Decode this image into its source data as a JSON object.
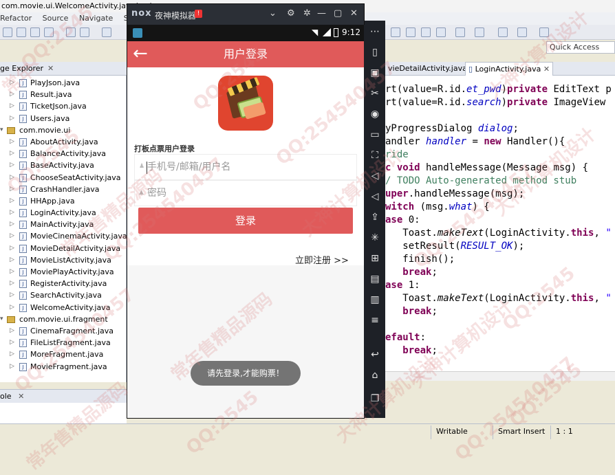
{
  "eclipse": {
    "window_title": "com.movie.ui.WelcomeActivity.java/src/co",
    "menu": [
      "Refactor",
      "Source",
      "Navigate",
      "Se"
    ],
    "quick_access": "Quick Access",
    "package_explorer_title": "ge Explorer",
    "tree": [
      {
        "type": "file",
        "label": "PlayJson.java"
      },
      {
        "type": "file",
        "label": "Result.java"
      },
      {
        "type": "file",
        "label": "TicketJson.java"
      },
      {
        "type": "file",
        "label": "Users.java"
      },
      {
        "type": "package",
        "label": "com.movie.ui"
      },
      {
        "type": "file",
        "label": "AboutActivity.java"
      },
      {
        "type": "file",
        "label": "BalanceActivity.java"
      },
      {
        "type": "file",
        "label": "BaseActivity.java"
      },
      {
        "type": "file",
        "label": "ChooseSeatActivity.java"
      },
      {
        "type": "file",
        "label": "CrashHandler.java"
      },
      {
        "type": "file",
        "label": "HHApp.java"
      },
      {
        "type": "file",
        "label": "LoginActivity.java"
      },
      {
        "type": "file",
        "label": "MainActivity.java"
      },
      {
        "type": "file",
        "label": "MovieCinemaActivity.java"
      },
      {
        "type": "file",
        "label": "MovieDetailActivity.java"
      },
      {
        "type": "file",
        "label": "MovieListActivity.java"
      },
      {
        "type": "file",
        "label": "MoviePlayActivity.java"
      },
      {
        "type": "file",
        "label": "RegisterActivity.java"
      },
      {
        "type": "file",
        "label": "SearchActivity.java"
      },
      {
        "type": "file",
        "label": "WelcomeActivity.java"
      },
      {
        "type": "package",
        "label": "com.movie.ui.fragment"
      },
      {
        "type": "file",
        "label": "CinemaFragment.java"
      },
      {
        "type": "file",
        "label": "FileListFragment.java"
      },
      {
        "type": "file",
        "label": "MoreFragment.java"
      },
      {
        "type": "file",
        "label": "MovieFragment.java"
      }
    ],
    "console_tab": "ole",
    "editor_tabs": [
      "vieDetailActivity.java",
      "LoginActivity.java"
    ],
    "status": {
      "writable": "Writable",
      "insert_mode": "Smart Insert",
      "position": "1 : 1"
    }
  },
  "emulator": {
    "logo": "nox",
    "name": "夜神模拟器",
    "badge": "!",
    "time": "9:12"
  },
  "app": {
    "title": "用户登录",
    "caption": "打板点票用户登录",
    "username_placeholder": "手机号/邮箱/用户名",
    "password_placeholder": "密码",
    "login_button": "登录",
    "register_link": "立即注册 >>",
    "toast": "请先登录,才能购票！"
  },
  "watermarks": [
    "QQ:2545",
    "常年",
    "大神计算机设计",
    "QQ:2545",
    "QQ:254540457",
    "大神计算机设计",
    "QQ:2545",
    "常年售精品源码",
    "QQ:254540457",
    "大神计算机设计",
    "QQ:254540457",
    "常年售精品源码",
    "QQ:254540457",
    "大神计算机设计",
    "QQ:2545",
    "QQ:254540457",
    "常年售精品源码",
    "QQ:2545",
    "大神计算机设计",
    "QQ:2545"
  ]
}
